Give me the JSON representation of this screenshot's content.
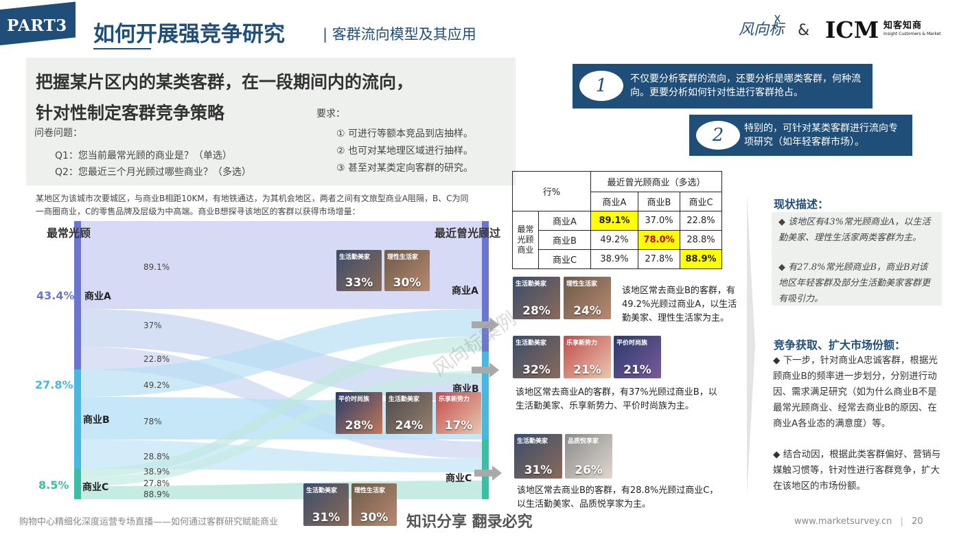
{
  "header": {
    "part": "PART3",
    "title": "如何开展强竞争研究",
    "subtitle": "| 客群流向模型及其应用",
    "logo1_text": "风向标",
    "amp": "&",
    "logo2_text": "ICM",
    "logo2_cn": "知客知商",
    "logo2_en": "Insight Customers & Market"
  },
  "intro": {
    "headline1": "把握某片区内的某类客群，在一段期间内的流向，",
    "headline2": "针对性制定客群竞争策略",
    "question_label": "问卷问题：",
    "q1": "Q1：您当前最常光顾的商业是？（单选）",
    "q2": "Q2：您最近三个月光顾过哪些商业？（多选）",
    "req_label": "要求：",
    "req1": "① 可进行等额本竞品到店抽样。",
    "req2": "② 也可对某地理区域进行抽样。",
    "req3": "③ 甚至对某类定向客群的研究。",
    "background": "某地区为该城市次要城区，与商业B相距10KM，有地铁通达，为其机会地区，两者之间有文旅型商业A阻隔，B、C为同一商圈商业，C的零售品牌及层级为中高端。商业B想探寻该地区的客群以获得市场增量："
  },
  "callouts": [
    {
      "num": "1",
      "text": "不仅要分析客群的流向，还要分析是哪类客群，何种流向。更要分析如何针对性进行客群抢占。"
    },
    {
      "num": "2",
      "text": "特别的，可针对某类客群进行流向专项研究（如年轻客群市场）。"
    }
  ],
  "sankey": {
    "left_title": "最常光顾",
    "right_title": "最近曾光顾过",
    "left_nodes": [
      {
        "label": "商业A",
        "share": "43.4%",
        "color": "#6a75d1"
      },
      {
        "label": "商业B",
        "share": "27.8%",
        "color": "#48b8e0"
      },
      {
        "label": "商业C",
        "share": "8.5%",
        "color": "#3bbfa4"
      }
    ],
    "right_nodes": [
      {
        "label": "商业A",
        "color": "#6a75d1"
      },
      {
        "label": "商业B",
        "color": "#48b8e0"
      },
      {
        "label": "商业C",
        "color": "#3bbfa4"
      }
    ],
    "flow_labels": {
      "a_a": "89.1%",
      "a_b": "37%",
      "a_c": "22.8%",
      "b_a": "49.2%",
      "b_b": "78%",
      "b_c": "28.8%",
      "c_a": "38.9%",
      "c_b": "27.8%",
      "c_c": "88.9%"
    }
  },
  "photos": {
    "a": [
      {
        "tag": "生活勤美家",
        "pct": "33%"
      },
      {
        "tag": "理性生活家",
        "pct": "30%"
      }
    ],
    "b": [
      {
        "tag": "平价时尚族",
        "pct": "28%"
      },
      {
        "tag": "生活勤美家",
        "pct": "24%"
      },
      {
        "tag": "乐享新势力",
        "pct": "17%"
      }
    ],
    "c": [
      {
        "tag": "生活勤美家",
        "pct": "31%"
      },
      {
        "tag": "理性生活家",
        "pct": "30%"
      }
    ],
    "r1": [
      {
        "tag": "生活勤美家",
        "pct": "28%"
      },
      {
        "tag": "理性生活家",
        "pct": "24%"
      }
    ],
    "r2": [
      {
        "tag": "生活勤美家",
        "pct": "32%"
      },
      {
        "tag": "乐享新势力",
        "pct": "21%"
      },
      {
        "tag": "平价时尚族",
        "pct": "21%"
      }
    ],
    "r3": [
      {
        "tag": "生活勤美家",
        "pct": "31%"
      },
      {
        "tag": "品质悦享家",
        "pct": "26%"
      }
    ]
  },
  "table": {
    "corner": "行%",
    "col_group": "最近曾光顾商业（多选）",
    "row_group": "最常光顾商业",
    "cols": [
      "商业A",
      "商业B",
      "商业C"
    ],
    "rows": [
      {
        "label": "商业A",
        "values": [
          "89.1%",
          "37.0%",
          "22.8%"
        ]
      },
      {
        "label": "商业B",
        "values": [
          "49.2%",
          "78.0%",
          "28.8%"
        ]
      },
      {
        "label": "商业C",
        "values": [
          "38.9%",
          "27.8%",
          "88.9%"
        ]
      }
    ]
  },
  "descriptions": {
    "d1": "该地区常去商业B的客群，有49.2%光顾过商业A，以生活勤美家、理性生活家为主。",
    "d2": "该地区常去商业A的客群，有37%光顾过商业B，以生活勤美家、乐享新势力、平价时尚族为主。",
    "d3": "该地区常去商业B的客群，有28.8%光顾过商业C，以生活勤美家、品质悦享家为主。"
  },
  "right_panel": {
    "status_title": "现状描述：",
    "status_items": [
      "该地区有43%常光顾商业A，以生活勤美家、理性生活家两类客群为主。",
      "有27.8%常光顾商业B，商业B对该地区年轻客群及部分生活勤美家客群更有吸引力。"
    ],
    "compete_title": "竞争获取、扩大市场份额：",
    "compete_items": [
      "下一步，针对商业A忠诚客群，根据光顾商业B的频率进一步划分，分别进行动因、需求满足研究（如为什么商业B不是最常光顾商业、经常去商业B的原因、在商业A各业态的满意度）等。",
      "结合动因，根据此类客群偏好、营销与媒触习惯等，针对性进行客群竞争，扩大在该地区的市场份额。"
    ]
  },
  "footer": {
    "left": "购物中心精细化深度运营专场直播——如何通过客群研究赋能商业",
    "mid": "知识分享 翻录必究",
    "url": "www.marketsurvey.cn",
    "page": "20"
  },
  "watermark": "风向标案例"
}
